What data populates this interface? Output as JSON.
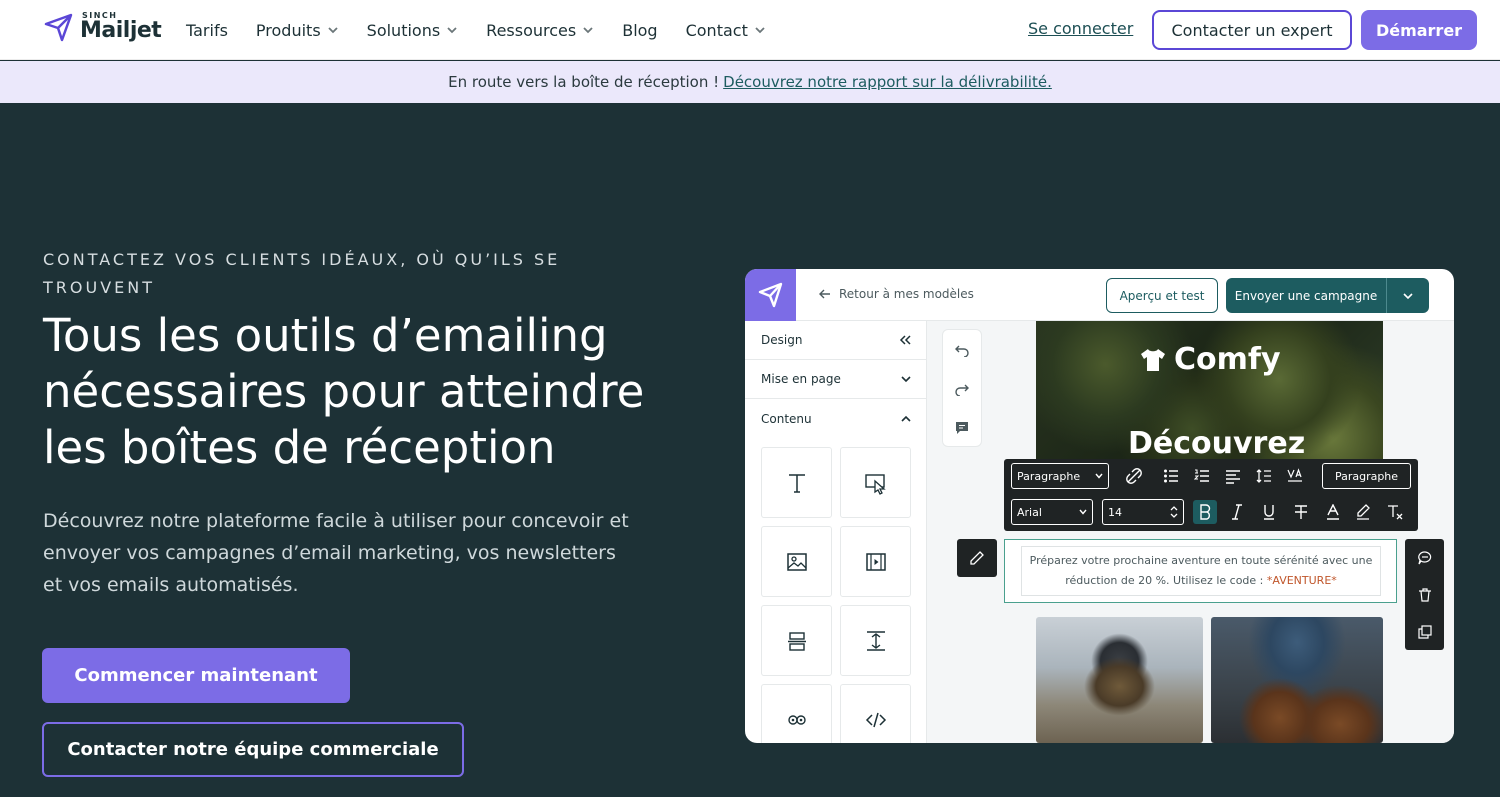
{
  "nav": {
    "logo_top": "SINCH",
    "logo_name": "Mailjet",
    "items": [
      {
        "label": "Tarifs",
        "dropdown": false
      },
      {
        "label": "Produits",
        "dropdown": true
      },
      {
        "label": "Solutions",
        "dropdown": true
      },
      {
        "label": "Ressources",
        "dropdown": true
      },
      {
        "label": "Blog",
        "dropdown": false
      },
      {
        "label": "Contact",
        "dropdown": true
      }
    ],
    "login": "Se connecter",
    "expert": "Contacter un expert",
    "start": "Démarrer"
  },
  "banner": {
    "text": "En route vers la boîte de réception !",
    "link": "Découvrez notre rapport sur la délivrabilité."
  },
  "hero": {
    "eyebrow": "CONTACTEZ VOS CLIENTS IDÉAUX, OÙ QU’ILS SE TROUVENT",
    "headline": "Tous les outils d’emailing nécessaires pour atteindre les boîtes de réception",
    "lede": "Découvrez notre plateforme facile à utiliser pour concevoir et envoyer vos campagnes d’email marketing, vos newsletters et vos emails automatisés.",
    "cta_primary": "Commencer maintenant",
    "cta_secondary": "Contacter notre équipe commerciale"
  },
  "editor": {
    "back": "Retour à mes modèles",
    "preview": "Aperçu et test",
    "send": "Envoyer une campagne",
    "sidebar": {
      "design": "Design",
      "layout": "Mise en page",
      "content": "Contenu"
    },
    "brand": "Comfy",
    "hero_title": "Découvrez",
    "toolbar": {
      "block_type": "Paragraphe",
      "style_button": "Paragraphe",
      "font": "Arial",
      "size": "14"
    },
    "body_text": "Préparez votre prochaine aventure en toute sérénité avec une réduction de 20 %. Utilisez le code :",
    "promo_code": "*AVENTURE*"
  },
  "colors": {
    "accent": "#7c6ce6",
    "hero_bg": "#1d3136",
    "teal": "#1d5c60",
    "banner_bg": "#ebe8fb"
  }
}
